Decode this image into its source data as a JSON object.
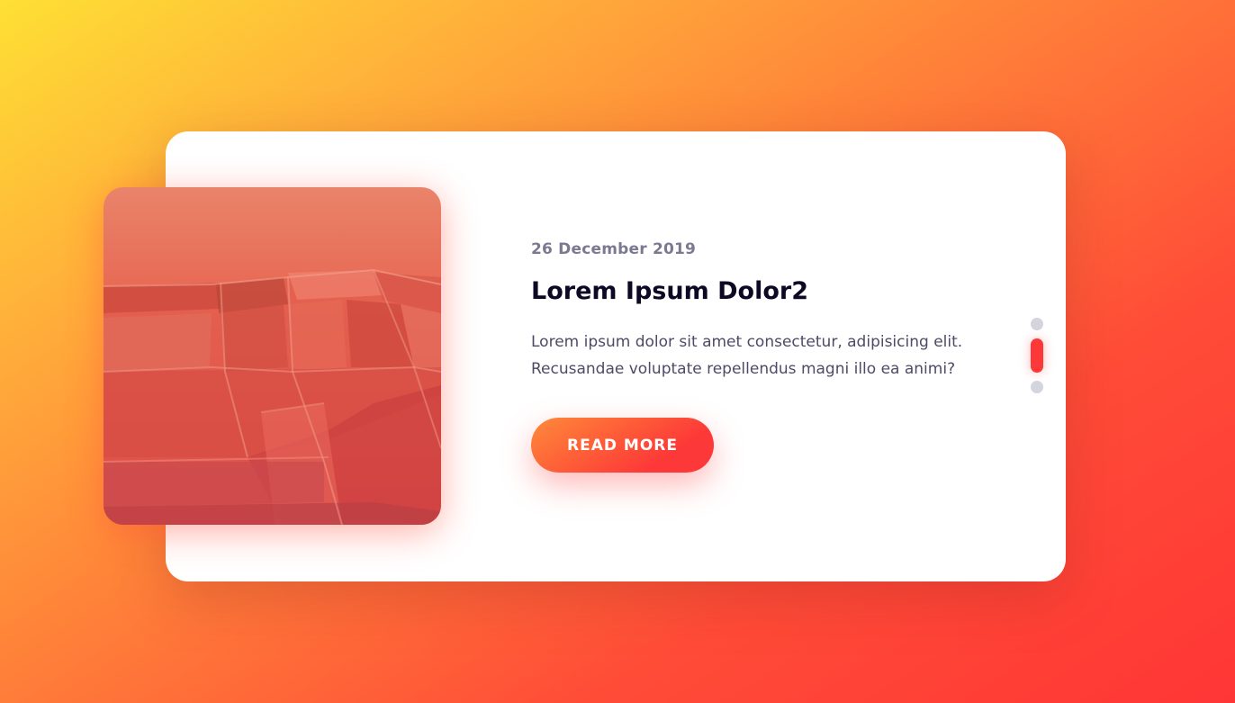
{
  "post": {
    "date": "26 December 2019",
    "title": "Lorem Ipsum Dolor2",
    "text": "Lorem ipsum dolor sit amet consectetur, adipisicing elit. Recusandae voluptate repellendus magni illo ea animi?",
    "button_label": "READ MORE",
    "image": "building-facade-photo"
  },
  "pagination": {
    "total": 3,
    "active_index": 1
  },
  "colors": {
    "accent": "#fd3838",
    "accent_start": "#fe8a39",
    "title": "#0d0925",
    "date": "#7b7992",
    "body_text": "#4e4a67",
    "dot_inactive": "#d4d4dc"
  }
}
